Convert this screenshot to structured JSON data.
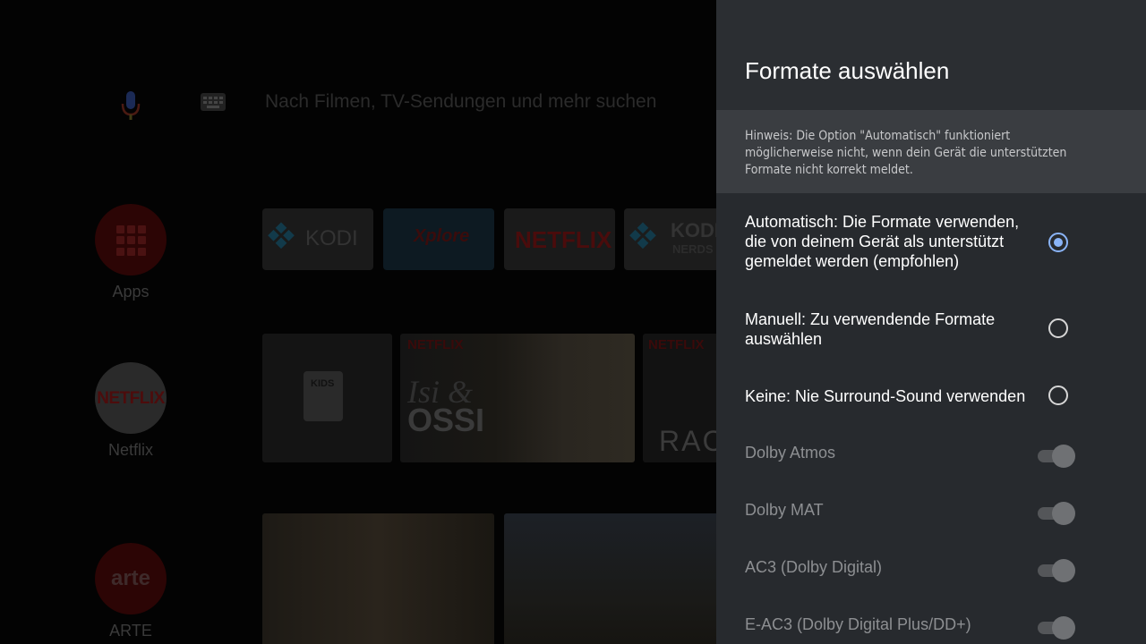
{
  "home": {
    "search_placeholder": "Nach Filmen, TV-Sendungen und mehr suchen",
    "rail": [
      {
        "label": "Apps"
      },
      {
        "label": "Netflix",
        "logo_text": "NETFLIX"
      },
      {
        "label": "ARTE",
        "logo_text": "arte"
      }
    ],
    "apps_row": [
      {
        "name": "KODI"
      },
      {
        "name": "Xplore"
      },
      {
        "name": "NETFLIX"
      },
      {
        "name": "KODI",
        "subtitle": "NERDS"
      }
    ],
    "netflix_row": {
      "kids_label": "KIDS",
      "badge": "NETFLIX",
      "show_title_line1": "Isi &",
      "show_title_line2": "OSSI",
      "partial_title": "RAC"
    }
  },
  "panel": {
    "title": "Formate auswählen",
    "hint": "Hinweis: Die Option \"Automatisch\" funktioniert möglicherweise nicht, wenn dein Gerät die unterstützten Formate nicht korrekt meldet.",
    "options": [
      {
        "label": "Automatisch: Die Formate verwenden, die von deinem Gerät als unterstützt gemeldet werden (empfohlen)",
        "selected": true
      },
      {
        "label": "Manuell: Zu verwendende Formate auswählen",
        "selected": false
      },
      {
        "label": "Keine: Nie Surround-Sound verwenden",
        "selected": false
      }
    ],
    "formats": [
      {
        "label": "Dolby Atmos",
        "enabled": false
      },
      {
        "label": "Dolby MAT",
        "enabled": false
      },
      {
        "label": "AC3 (Dolby Digital)",
        "enabled": false
      },
      {
        "label": "E-AC3 (Dolby Digital Plus/DD+)",
        "enabled": false
      }
    ],
    "accent_color": "#8ab4f8"
  }
}
